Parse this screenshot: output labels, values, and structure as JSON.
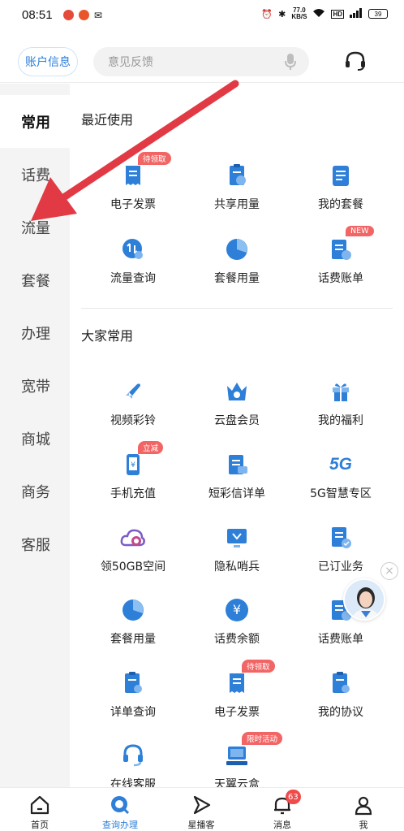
{
  "status_bar": {
    "time": "08:51",
    "speed": "77.0",
    "speed_unit": "KB/S",
    "battery": "39"
  },
  "topbar": {
    "account_label": "账户信息",
    "search_placeholder": "意见反馈"
  },
  "sidebar": {
    "items": [
      {
        "label": "常用",
        "active": true
      },
      {
        "label": "话费"
      },
      {
        "label": "流量"
      },
      {
        "label": "套餐"
      },
      {
        "label": "办理"
      },
      {
        "label": "宽带"
      },
      {
        "label": "商城"
      },
      {
        "label": "商务"
      },
      {
        "label": "客服"
      }
    ]
  },
  "recent": {
    "title": "最近使用",
    "items": [
      {
        "label": "电子发票",
        "badge": "待领取",
        "icon": "invoice-icon"
      },
      {
        "label": "共享用量",
        "icon": "share-clipboard-icon"
      },
      {
        "label": "我的套餐",
        "icon": "package-list-icon"
      },
      {
        "label": "流量查询",
        "icon": "data-query-icon"
      },
      {
        "label": "套餐用量",
        "icon": "pie-chart-icon"
      },
      {
        "label": "话费账单",
        "badge": "NEW",
        "icon": "bill-icon"
      }
    ]
  },
  "common": {
    "title": "大家常用",
    "items": [
      {
        "label": "视频彩铃",
        "icon": "rocket-icon"
      },
      {
        "label": "云盘会员",
        "icon": "crown-cloud-icon"
      },
      {
        "label": "我的福利",
        "icon": "gift-icon"
      },
      {
        "label": "手机充值",
        "badge": "立减",
        "icon": "phone-recharge-icon"
      },
      {
        "label": "短彩信详单",
        "icon": "sms-detail-icon"
      },
      {
        "label": "5G智慧专区",
        "icon": "5g-icon",
        "icon_text": "5G"
      },
      {
        "label": "领50GB空间",
        "icon": "cloud-storage-icon"
      },
      {
        "label": "隐私哨兵",
        "icon": "privacy-monitor-icon"
      },
      {
        "label": "已订业务",
        "icon": "subscribed-icon"
      },
      {
        "label": "套餐用量",
        "icon": "pie-chart-icon"
      },
      {
        "label": "话费余额",
        "icon": "yuan-balance-icon",
        "icon_text": "¥"
      },
      {
        "label": "话费账单",
        "icon": "bill-icon"
      },
      {
        "label": "详单查询",
        "icon": "detail-query-icon"
      },
      {
        "label": "电子发票",
        "badge": "待领取",
        "icon": "invoice-icon"
      },
      {
        "label": "我的协议",
        "icon": "agreement-icon"
      },
      {
        "label": "在线客服",
        "icon": "headset-icon"
      },
      {
        "label": "天翼云盒",
        "badge": "限时活动",
        "icon": "cloud-box-icon"
      }
    ]
  },
  "bottom_tabs": [
    {
      "label": "首页",
      "icon": "home-icon"
    },
    {
      "label": "查询办理",
      "icon": "query-icon",
      "active": true
    },
    {
      "label": "星播客",
      "icon": "play-icon"
    },
    {
      "label": "消息",
      "icon": "bell-icon",
      "badge": "63"
    },
    {
      "label": "我",
      "icon": "person-icon"
    }
  ],
  "colors": {
    "accent": "#2d7fd8",
    "badge": "#f26565",
    "arrow": "#e23a45",
    "sidebar_bg": "#f4f4f4"
  }
}
